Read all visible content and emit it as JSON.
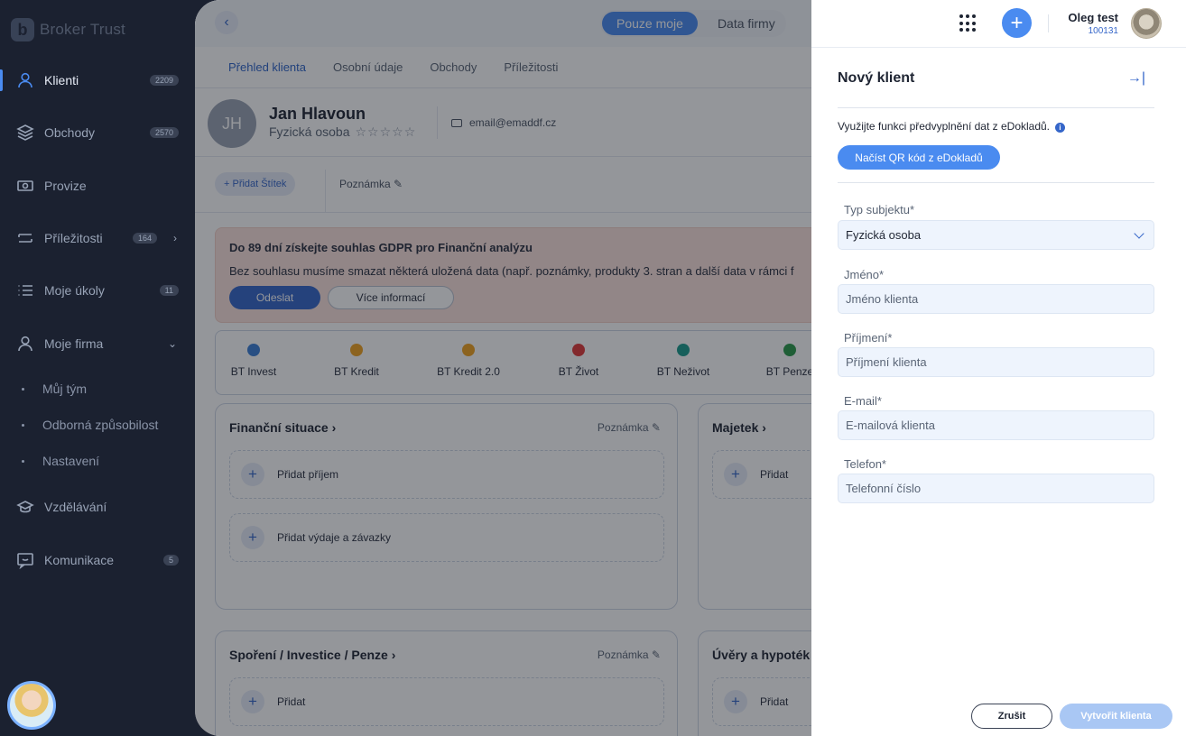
{
  "sidebar": {
    "logo_text": "Broker Trust",
    "logo_mark": "b",
    "items": [
      {
        "label": "Klienti",
        "count": "2209",
        "icon": "user-icon"
      },
      {
        "label": "Obchody",
        "count": "2570",
        "icon": "layers-icon"
      },
      {
        "label": "Provize",
        "count": "",
        "icon": "money-icon"
      },
      {
        "label": "Příležitosti",
        "count": "164",
        "icon": "swap-icon"
      },
      {
        "label": "Moje úkoly",
        "count": "11",
        "icon": "list-icon"
      },
      {
        "label": "Moje firma",
        "count": "",
        "icon": "person-icon"
      },
      {
        "label": "Vzdělávání",
        "count": "",
        "icon": "graduation-icon"
      },
      {
        "label": "Komunikace",
        "count": "5",
        "icon": "chat-icon"
      }
    ],
    "sub_items": [
      "Můj tým",
      "Odborná způsobilost",
      "Nastavení"
    ],
    "chevron_right": "›",
    "chevron_down": "⌄"
  },
  "main": {
    "back": "‹",
    "toggle": {
      "on": "Pouze moje",
      "off": "Data firmy"
    },
    "tabs": [
      "Přehled klienta",
      "Osobní údaje",
      "Obchody",
      "Příležitosti"
    ],
    "client": {
      "initials": "JH",
      "name": "Jan Hlavoun",
      "type": "Fyzická osoba",
      "stars": "☆☆☆☆☆",
      "email": "email@emaddf.cz"
    },
    "tag_button": "+ Přidat Štítek",
    "note": "Poznámka ✎",
    "gdpr": {
      "title": "Do 89 dní získejte souhlas GDPR pro Finanční analýzu",
      "text": "Bez souhlasu musíme smazat některá uložená data (např. poznámky, produkty 3. stran a další data v rámci f",
      "send": "Odeslat",
      "more": "Více informací"
    },
    "products": [
      {
        "label": "BT Invest",
        "color": "#3b7fd6"
      },
      {
        "label": "BT Kredit",
        "color": "#f0a21f"
      },
      {
        "label": "BT Kredit 2.0",
        "color": "#f0a21f"
      },
      {
        "label": "BT Život",
        "color": "#e03a3a"
      },
      {
        "label": "BT Neživot",
        "color": "#1a9c8c"
      },
      {
        "label": "BT Penze",
        "color": "#2a9a4a"
      }
    ],
    "cards": {
      "financial": {
        "title": "Finanční situace ›",
        "note": "Poznámka ✎",
        "add1": "Přidat příjem",
        "add2": "Přidat výdaje a závazky"
      },
      "assets": {
        "title": "Majetek ›",
        "add": "Přidat"
      },
      "savings": {
        "title": "Spoření / Investice / Penze ›",
        "note": "Poznámka ✎",
        "add": "Přidat"
      },
      "loans": {
        "title": "Úvěry a hypoték",
        "add": "Přidat"
      }
    },
    "plus": "+"
  },
  "panel": {
    "user_name": "Oleg test",
    "user_id": "100131",
    "add": "+",
    "title": "Nový klient",
    "collapse": "→|",
    "hint": "Využijte funkci předvyplnění dat z eDokladů.",
    "info": "i",
    "qr_button": "Načíst QR kód z eDokladů",
    "fields": {
      "subject_type": {
        "label": "Typ subjektu*",
        "value": "Fyzická osoba"
      },
      "first_name": {
        "label": "Jméno*",
        "placeholder": "Jméno klienta"
      },
      "last_name": {
        "label": "Příjmení*",
        "placeholder": "Příjmení klienta"
      },
      "email": {
        "label": "E-mail*",
        "placeholder": "E-mailová klienta"
      },
      "phone": {
        "label": "Telefon*",
        "placeholder": "Telefonní číslo"
      }
    },
    "cancel": "Zrušit",
    "create": "Vytvořit klienta"
  },
  "colors": {
    "accent": "#4a8bf0",
    "sidebar": "#1b2130",
    "gdpr_bg": "#fbe2dc"
  }
}
